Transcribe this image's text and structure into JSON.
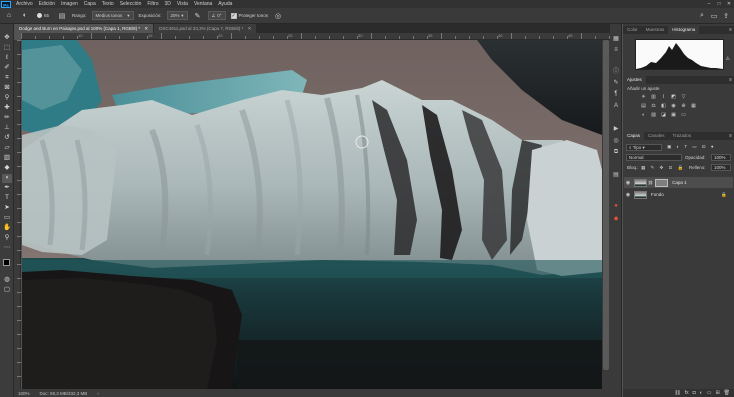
{
  "menubar": {
    "logo": "Ps",
    "items": [
      "Archivo",
      "Edición",
      "Imagen",
      "Capa",
      "Texto",
      "Selección",
      "Filtro",
      "3D",
      "Vista",
      "Ventana",
      "Ayuda"
    ],
    "window_controls": [
      "–",
      "□",
      "✕"
    ]
  },
  "options_bar": {
    "brush_size": "65",
    "range_label": "Rango:",
    "range_value": "Medios tonos",
    "exposure_label": "Exposición:",
    "exposure_value": "20%",
    "protect_label": "Proteger tonos",
    "protect_checked": true,
    "angle_value": "0°"
  },
  "doc_tabs": [
    {
      "label": "Dodge and Burn en Paisajes.psd al 100% (Capa 1, RGB/8) *",
      "active": true
    },
    {
      "label": "DSC4911.psd al 33,3% (Capa 7, RGB/8) *",
      "active": false
    }
  ],
  "ruler_top_labels": [
    "10",
    "15",
    "20",
    "25",
    "30",
    "35",
    "40",
    "45"
  ],
  "status": {
    "zoom": "100%",
    "doc_info": "Doc: 59,3 MB/332,3 MB"
  },
  "colors": {
    "fg": "#000000",
    "bg": "#ffffff",
    "panel_bg": "#3a3a3a",
    "accent": "#31a8ff"
  },
  "panels": {
    "top_tabs": [
      "Color",
      "Muestras",
      "Histograma"
    ],
    "active_top_tab": "Histograma",
    "adjust_tabs": [
      "Ajustes"
    ],
    "adjust_hint": "Añadir un ajuste",
    "layer_tabs": [
      "Capas",
      "Canales",
      "Trazados"
    ],
    "kind_label": "Tipo",
    "blend_mode": "Normal",
    "opacity_label": "Opacidad:",
    "opacity_value": "100%",
    "lock_label": "Bloq.:",
    "fill_label": "Relleno:",
    "fill_value": "100%",
    "layers": [
      {
        "name": "Capa 1",
        "selected": true
      },
      {
        "name": "Fondo",
        "selected": false
      }
    ]
  }
}
